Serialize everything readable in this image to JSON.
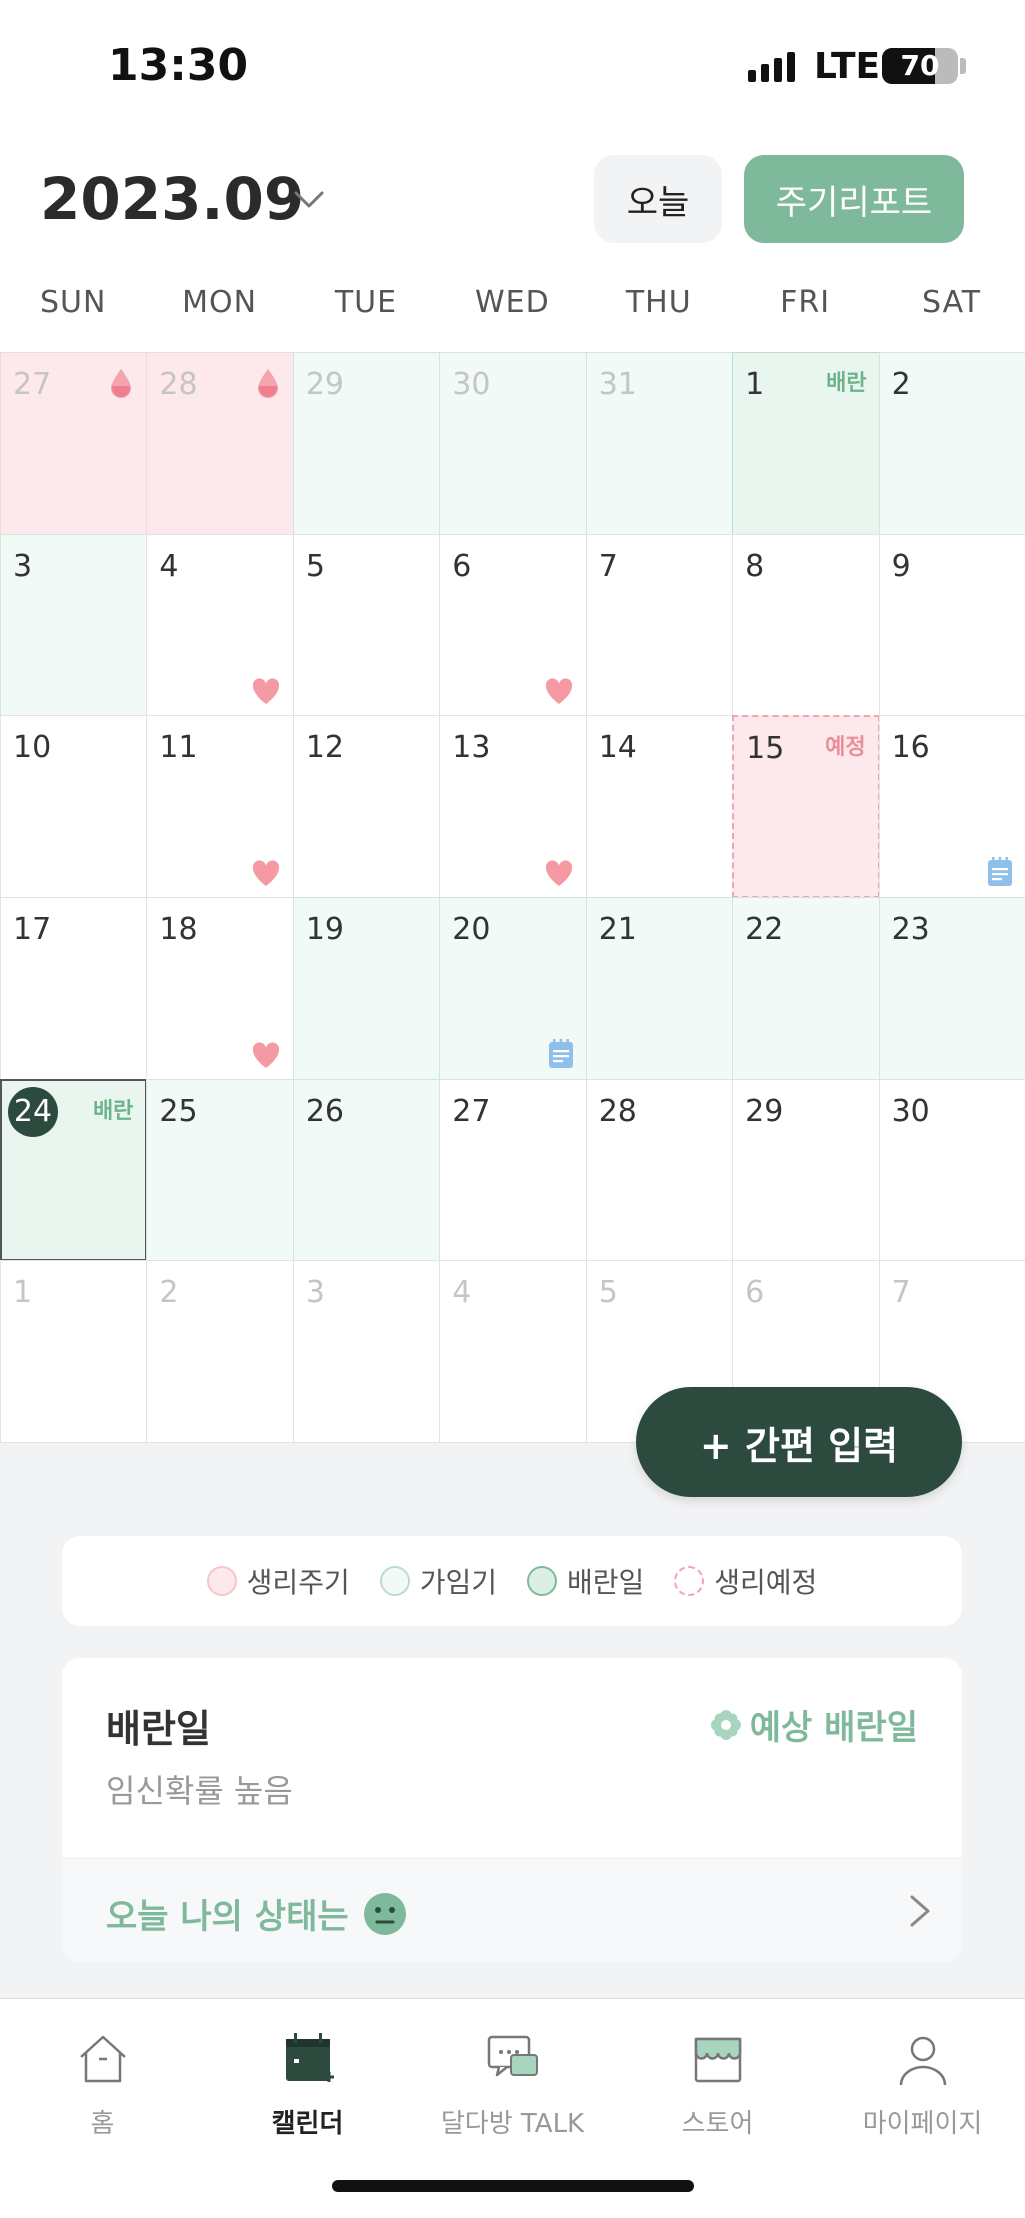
{
  "status_bar": {
    "time": "13:30",
    "network": "LTE",
    "battery": "70",
    "battery_level": 0.7
  },
  "header": {
    "month": "2023.09",
    "today_button": "오늘",
    "report_button": "주기리포트"
  },
  "weekdays": [
    "SUN",
    "MON",
    "TUE",
    "WED",
    "THU",
    "FRI",
    "SAT"
  ],
  "calendar": {
    "tags": {
      "ovulation": "배란",
      "predicted": "예정"
    },
    "weeks": [
      [
        {
          "day": "27",
          "state": "period",
          "dim": true,
          "icon": "drop-icon"
        },
        {
          "day": "28",
          "state": "period",
          "dim": true,
          "icon": "drop-icon"
        },
        {
          "day": "29",
          "state": "fertile",
          "dim": true
        },
        {
          "day": "30",
          "state": "fertile",
          "dim": true
        },
        {
          "day": "31",
          "state": "fertile",
          "dim": true
        },
        {
          "day": "1",
          "state": "ovulation",
          "tag": "ovulation"
        },
        {
          "day": "2",
          "state": "fertile"
        }
      ],
      [
        {
          "day": "3",
          "state": "fertile"
        },
        {
          "day": "4",
          "icon": "heart-icon"
        },
        {
          "day": "5"
        },
        {
          "day": "6",
          "icon": "heart-icon"
        },
        {
          "day": "7"
        },
        {
          "day": "8"
        },
        {
          "day": "9"
        }
      ],
      [
        {
          "day": "10"
        },
        {
          "day": "11",
          "icon": "heart-icon"
        },
        {
          "day": "12"
        },
        {
          "day": "13",
          "icon": "heart-icon"
        },
        {
          "day": "14"
        },
        {
          "day": "15",
          "state": "predicted",
          "tag": "predicted"
        },
        {
          "day": "16",
          "icon": "note-icon"
        }
      ],
      [
        {
          "day": "17"
        },
        {
          "day": "18",
          "icon": "heart-icon"
        },
        {
          "day": "19",
          "state": "fertile"
        },
        {
          "day": "20",
          "state": "fertile",
          "icon": "note-icon"
        },
        {
          "day": "21",
          "state": "fertile"
        },
        {
          "day": "22",
          "state": "fertile"
        },
        {
          "day": "23",
          "state": "fertile"
        }
      ],
      [
        {
          "day": "24",
          "state": "ovu-today",
          "tag": "ovulation",
          "today": true
        },
        {
          "day": "25",
          "state": "fertile"
        },
        {
          "day": "26",
          "state": "fertile"
        },
        {
          "day": "27"
        },
        {
          "day": "28"
        },
        {
          "day": "29"
        },
        {
          "day": "30"
        }
      ],
      [
        {
          "day": "1",
          "dim": true
        },
        {
          "day": "2",
          "dim": true
        },
        {
          "day": "3",
          "dim": true
        },
        {
          "day": "4",
          "dim": true
        },
        {
          "day": "5",
          "dim": true
        },
        {
          "day": "6",
          "dim": true
        },
        {
          "day": "7",
          "dim": true
        }
      ]
    ]
  },
  "fab": {
    "label": "+ 간편 입력"
  },
  "legend": [
    {
      "label": "생리주기",
      "type": "period"
    },
    {
      "label": "가임기",
      "type": "fertile"
    },
    {
      "label": "배란일",
      "type": "ovu"
    },
    {
      "label": "생리예정",
      "type": "pred"
    }
  ],
  "info_card": {
    "title": "배란일",
    "subtitle": "임신확률 높음",
    "badge": "예상 배란일",
    "status_prompt": "오늘 나의 상태는"
  },
  "bottom_nav": [
    {
      "label": "홈",
      "icon": "home-icon",
      "active": false
    },
    {
      "label": "캘린더",
      "icon": "calendar-icon",
      "active": true
    },
    {
      "label": "달다방 TALK",
      "icon": "chat-icon",
      "active": false
    },
    {
      "label": "스토어",
      "icon": "store-icon",
      "active": false
    },
    {
      "label": "마이페이지",
      "icon": "person-icon",
      "active": false
    }
  ],
  "colors": {
    "accent": "#7fb99b",
    "dark": "#2d4a3e",
    "period": "#fde9ec",
    "fertile": "#f1faf6",
    "heart": "#f59aa3",
    "note": "#8fc0ea"
  }
}
